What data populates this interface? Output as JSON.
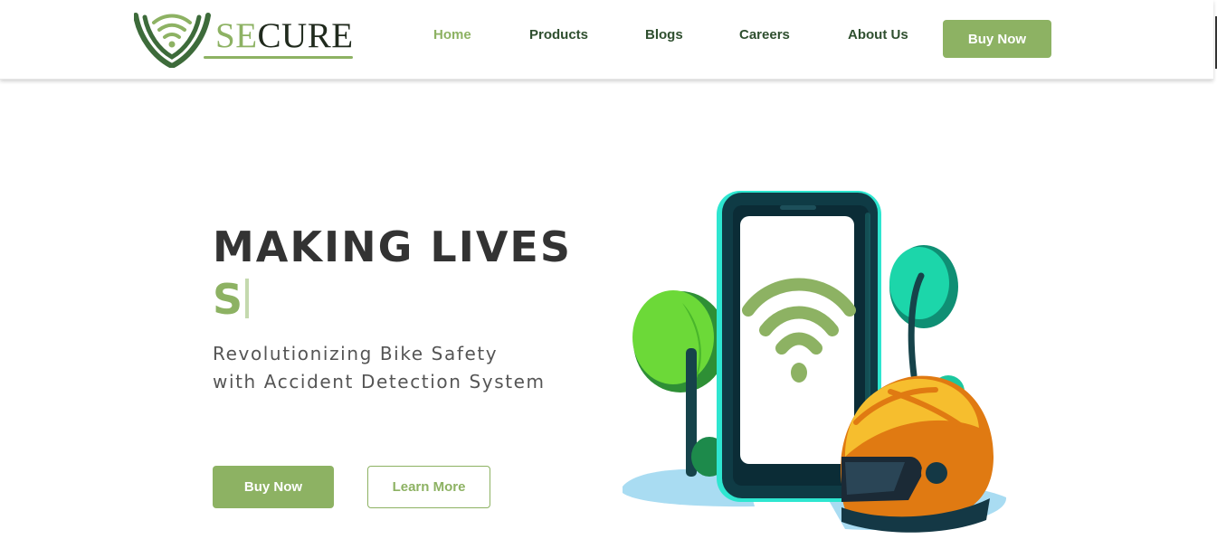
{
  "brand": {
    "name_highlight": "SE",
    "name_rest": "CURE",
    "colors": {
      "primary": "#8db263",
      "dark": "#2f4f2f",
      "text": "#333333"
    }
  },
  "nav": {
    "items": [
      {
        "label": "Home",
        "active": true
      },
      {
        "label": "Products"
      },
      {
        "label": "Blogs"
      },
      {
        "label": "Careers"
      },
      {
        "label": "About Us"
      }
    ],
    "cta_label": "Buy Now"
  },
  "hero": {
    "title": "MAKING LIVES",
    "typed_text": "S",
    "subtitle_line1": "Revolutionizing Bike Safety",
    "subtitle_line2": "with Accident Detection System",
    "primary_button": "Buy Now",
    "secondary_button": "Learn More"
  },
  "illustration": {
    "icons": [
      "smartphone-icon",
      "wifi-signal-icon",
      "helmet-icon",
      "tree-icon"
    ]
  }
}
